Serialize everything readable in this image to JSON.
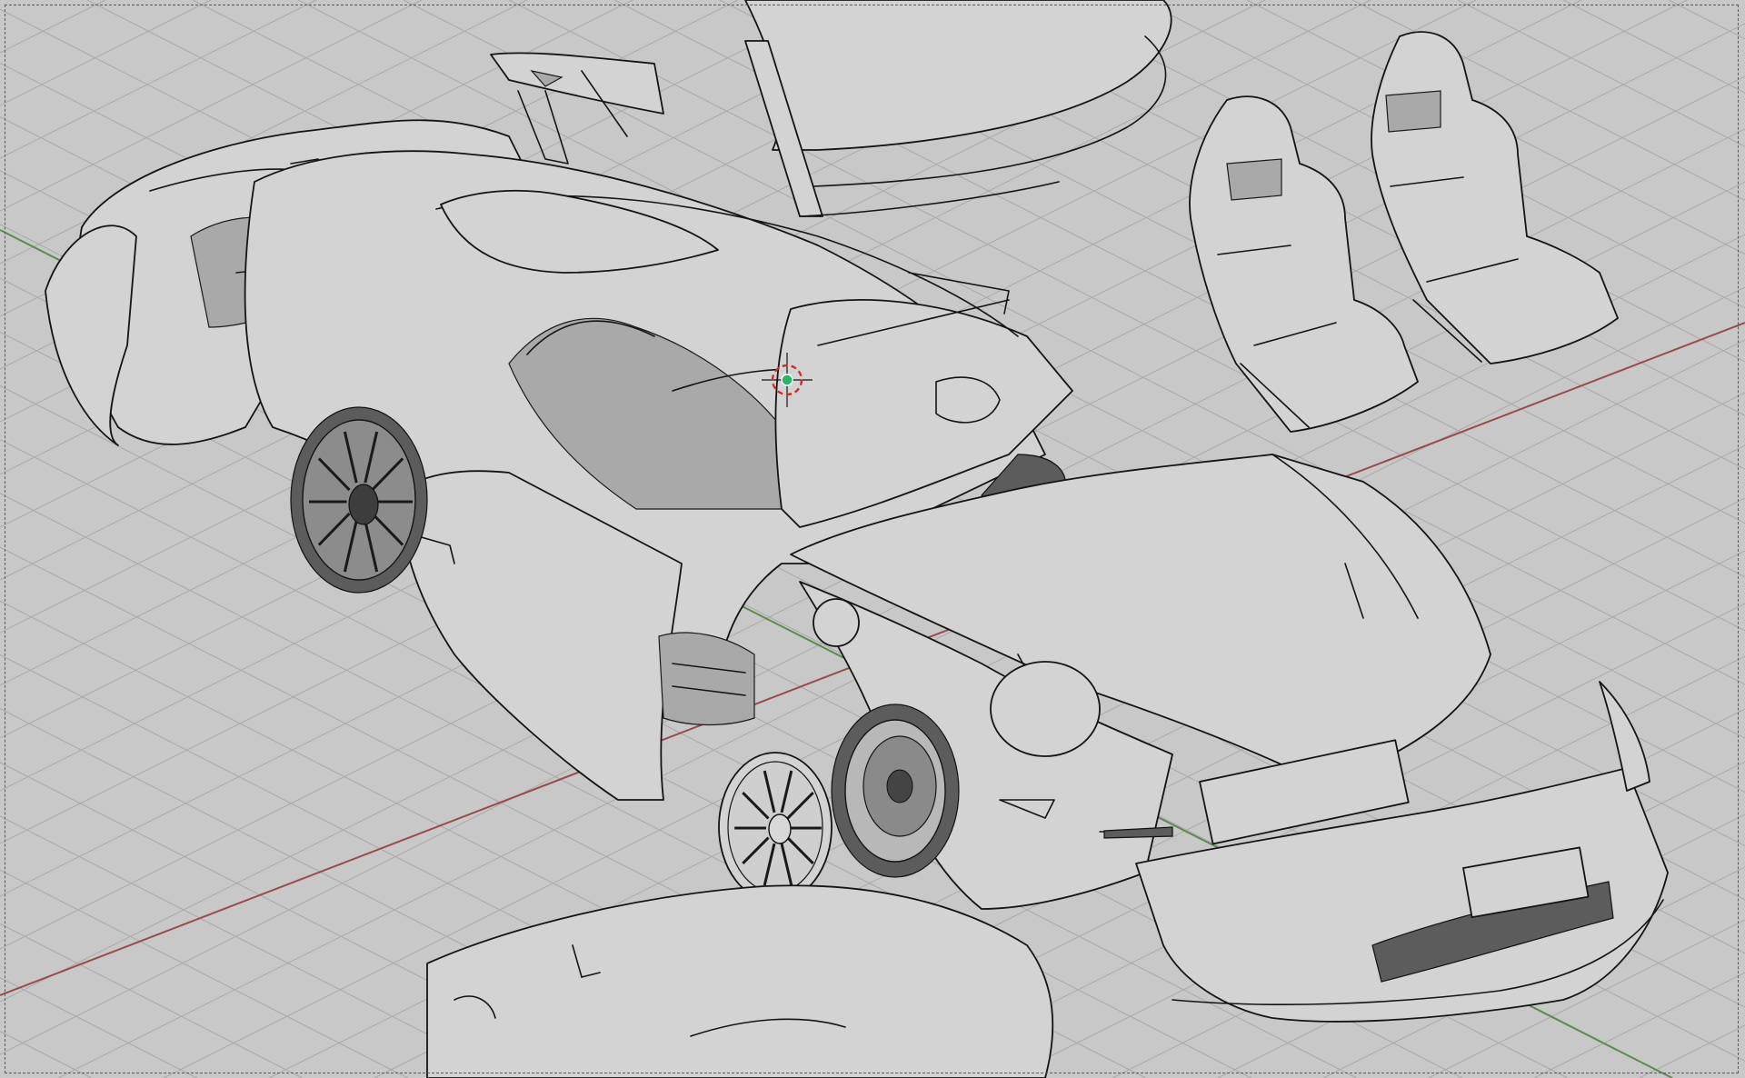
{
  "viewport": {
    "background_color": "#c8c8c8",
    "grid_color": "#a9a9a9",
    "x_axis_color": "#9b4a4a",
    "y_axis_color": "#5b8b4f",
    "line_color": "#141414"
  },
  "scene_objects": [
    {
      "name": "car-body"
    },
    {
      "name": "spoiler-wing"
    },
    {
      "name": "racing-seat-left"
    },
    {
      "name": "racing-seat-right"
    },
    {
      "name": "front-bumper"
    },
    {
      "name": "rear-wheel"
    },
    {
      "name": "front-wheel"
    },
    {
      "name": "detached-rim"
    },
    {
      "name": "door-panel"
    },
    {
      "name": "hood-panel"
    },
    {
      "name": "roof-panel"
    }
  ],
  "cursor_3d": {
    "outer_color": "#d22b2b",
    "inner_color": "#2bb36b"
  }
}
